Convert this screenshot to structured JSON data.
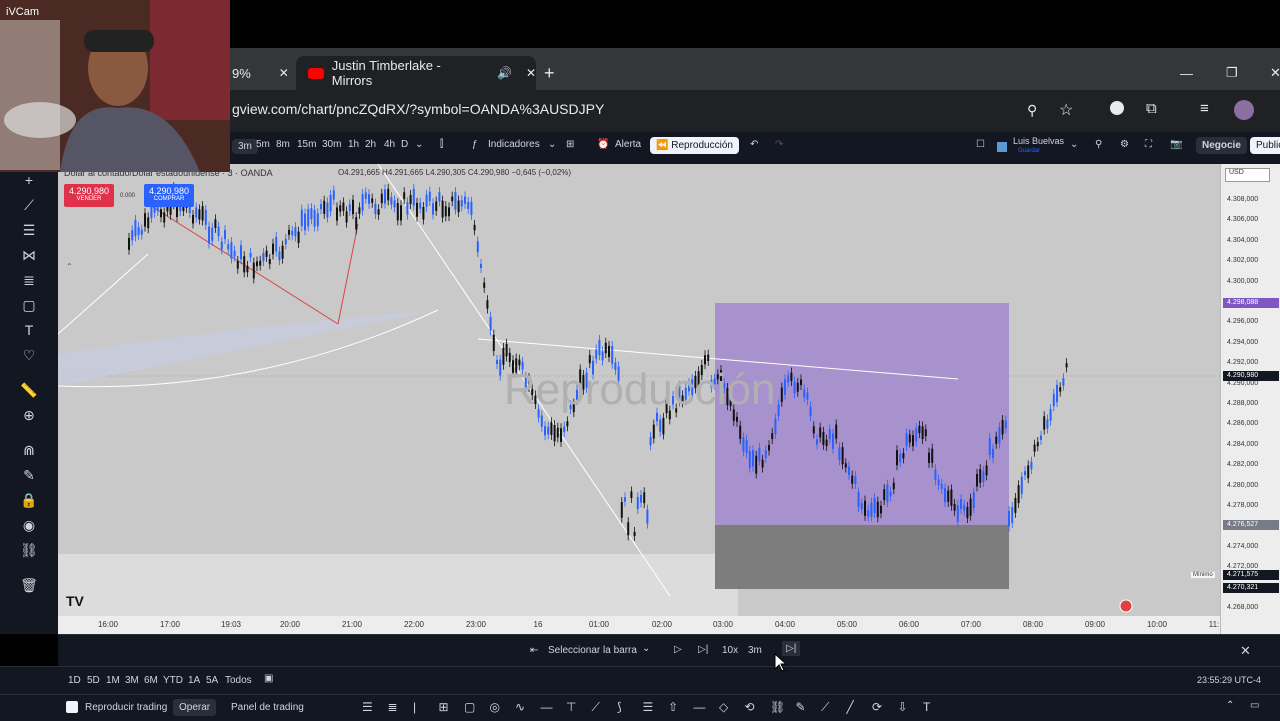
{
  "webcam": {
    "label": "iVCam"
  },
  "browser": {
    "tab1_label": "9%",
    "tab2_title": "Justin Timberlake - Mirrors",
    "new_tab": "+",
    "url": "gview.com/chart/pncZQdRX/?symbol=OANDA%3AUSDJPY",
    "window_min": "—",
    "window_restore": "❐",
    "window_close": "✕"
  },
  "toolbar": {
    "intervals": [
      "3m",
      "5m",
      "8m",
      "15m",
      "30m",
      "1h",
      "2h",
      "4h",
      "D"
    ],
    "indicators": "Indicadores",
    "alert": "Alerta",
    "replay": "Reproducción",
    "user_name": "Luis Buelvas",
    "user_sub": "Guardar",
    "trade": "Negocie",
    "publish": "Public"
  },
  "chart": {
    "symbol_title": "Dólar al contado/Dólar estadounidense · 3 · OANDA",
    "ohlc": "O4.291,665  H4.291,665  L4.290,305  C4.290,980  −0,645 (−0,02%)",
    "sell_price": "4.290,980",
    "sell_label": "VENDER",
    "spread": "0.000",
    "buy_price": "4.290,980",
    "buy_label": "COMPRAR",
    "watermark": "Reproducción",
    "currency": "USD",
    "y_ticks": [
      "4.308,000",
      "4.306,000",
      "4.304,000",
      "4.302,000",
      "4.300,000",
      "4.298,000",
      "4.296,000",
      "4.294,000",
      "4.292,000",
      "4.290,000",
      "4.288,000",
      "4.286,000",
      "4.284,000",
      "4.282,000",
      "4.280,000",
      "4.278,000",
      "4.276,000",
      "4.274,000",
      "4.272,000",
      "4.270,000",
      "4.268,000"
    ],
    "label_purple": "4.298,088",
    "label_current": "4.290,980",
    "label_grey1": "4.276,527",
    "label_min_text": "Mínimo",
    "label_min": "4.271,575",
    "label_grey2": "4.270,321",
    "x_ticks": [
      "16:00",
      "17:00",
      "19:03",
      "20:00",
      "21:00",
      "22:00",
      "23:00",
      "16",
      "01:00",
      "02:00",
      "03:00",
      "04:00",
      "05:00",
      "06:00",
      "07:00",
      "08:00",
      "09:00",
      "10:00",
      "11:"
    ],
    "logo": "TV"
  },
  "replay": {
    "select_bar": "Seleccionar la barra",
    "speed": "10x",
    "interval": "3m"
  },
  "timeframes": {
    "items": [
      "1D",
      "5D",
      "1M",
      "3M",
      "6M",
      "YTD",
      "1A",
      "5A",
      "Todos"
    ],
    "clock": "23:55:29 UTC-4"
  },
  "bottom": {
    "replay_trading": "Reproducir trading",
    "operate": "Operar",
    "trading_panel": "Panel de trading"
  },
  "colors": {
    "purple_zone": "#9b7fcf",
    "grey_zone": "#7d7d7d",
    "candle_up": "#2962ff",
    "candle_down": "#111111",
    "sell": "#e0304a",
    "buy": "#2962ff"
  }
}
